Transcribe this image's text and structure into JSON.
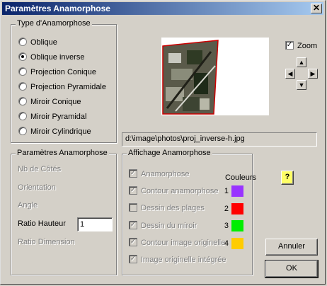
{
  "window": {
    "title": "Paramètres Anamorphose",
    "close_label": "✕"
  },
  "type_group": {
    "legend": "Type d'Anamorphose",
    "options": [
      {
        "label": "Oblique",
        "checked": false
      },
      {
        "label": "Oblique inverse",
        "checked": true
      },
      {
        "label": "Projection Conique",
        "checked": false
      },
      {
        "label": "Projection Pyramidale",
        "checked": false
      },
      {
        "label": "Miroir Conique",
        "checked": false
      },
      {
        "label": "Miroir Pyramidal",
        "checked": false
      },
      {
        "label": "Miroir Cylindrique",
        "checked": false
      }
    ]
  },
  "preview": {
    "zoom_label": "Zoom",
    "zoom_checked": true,
    "path": "d:\\image\\photos\\proj_inverse-h.jpg"
  },
  "params_group": {
    "legend": "Paramètres Anamorphose",
    "nb_cotes_label": "Nb de Côtés",
    "orientation_label": "Orientation",
    "angle_label": "Angle",
    "ratio_hauteur_label": "Ratio Hauteur",
    "ratio_hauteur_value": "1",
    "ratio_dimension_label": "Ratio Dimension"
  },
  "display_group": {
    "legend": "Affichage Anamorphose",
    "colors_header": "Couleurs",
    "items": [
      {
        "label": "Anamorphose",
        "checked": true,
        "number": "",
        "color": ""
      },
      {
        "label": "Contour anamorphose",
        "checked": true,
        "number": "1",
        "color": "#9933ff"
      },
      {
        "label": "Dessin des plages",
        "checked": false,
        "number": "2",
        "color": "#ff0000"
      },
      {
        "label": "Dessin du miroir",
        "checked": true,
        "number": "3",
        "color": "#00ee00"
      },
      {
        "label": "Contour image originelle",
        "checked": true,
        "number": "4",
        "color": "#ffcc00"
      },
      {
        "label": "Image originelle intégrée",
        "checked": true,
        "number": "",
        "color": ""
      }
    ]
  },
  "buttons": {
    "cancel_label": "Annuler",
    "ok_label": "OK",
    "help_label": "?"
  }
}
